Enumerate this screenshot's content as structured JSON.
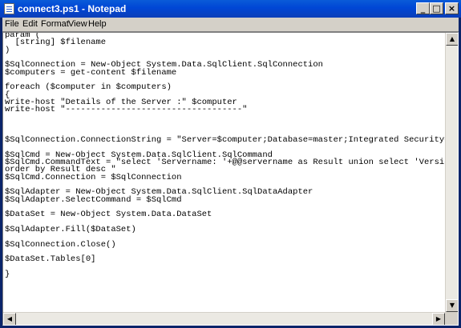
{
  "window": {
    "title": "connect3.ps1 - Notepad",
    "controls": {
      "minimize_icon": "minimize-icon",
      "maximize_icon": "maximize-icon",
      "close_icon": "close-icon"
    }
  },
  "menu": {
    "items": [
      {
        "label": "File"
      },
      {
        "label": "Edit"
      },
      {
        "label": "Format"
      },
      {
        "label": "View"
      },
      {
        "label": "Help"
      }
    ]
  },
  "editor": {
    "content": "param (\n  [string] $filename\n)\n\n$SqlConnection = New-Object System.Data.SqlClient.SqlConnection\n$computers = get-content $filename\n\nforeach ($computer in $computers)\n{\nwrite-host \"Details of the Server :\" $computer\nwrite-host \"-----------------------------------\"\n\n\n\n$SqlConnection.ConnectionString = \"Server=$computer;Database=master;Integrated Security=True\"\n\n$SqlCmd = New-Object System.Data.SqlClient.SqlCommand\n$SqlCmd.CommandText = \"select 'Servername: '+@@servername as Result union select 'Version: '+@@version as Result union select 'Database:' +name from sysdatabases as Result\norder by Result desc \"\n$SqlCmd.Connection = $SqlConnection\n\n$SqlAdapter = New-Object System.Data.SqlClient.SqlDataAdapter\n$SqlAdapter.SelectCommand = $SqlCmd\n\n$DataSet = New-Object System.Data.DataSet\n\n$SqlAdapter.Fill($DataSet)\n\n$SqlConnection.Close()\n\n$DataSet.Tables[0]\n\n}"
  },
  "colors": {
    "titlebar": "#0046d5",
    "chrome": "#d4d0c8",
    "editor_bg": "#ffffff"
  }
}
